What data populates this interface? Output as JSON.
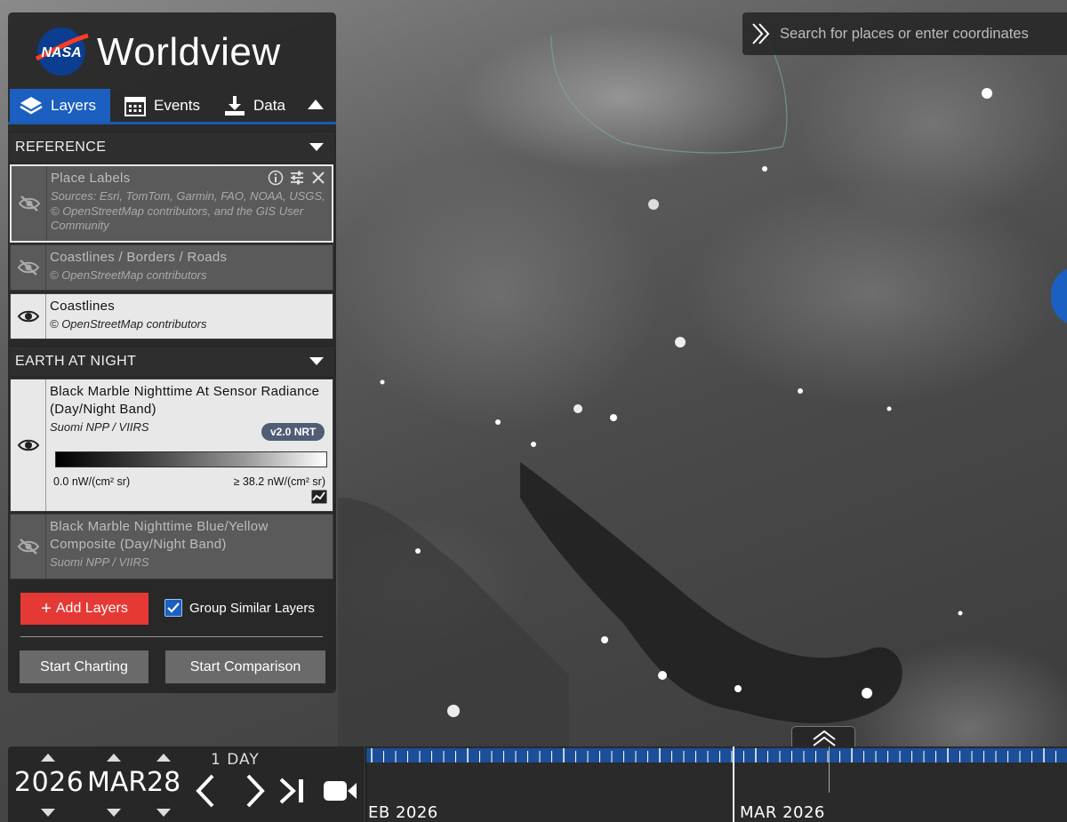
{
  "app": {
    "title": "Worldview",
    "logo_text": "NASA"
  },
  "tabs": [
    {
      "label": "Layers",
      "icon": "layers-icon",
      "active": true
    },
    {
      "label": "Events",
      "icon": "calendar-icon",
      "active": false
    },
    {
      "label": "Data",
      "icon": "download-icon",
      "active": false
    }
  ],
  "groups": {
    "reference": {
      "title": "REFERENCE",
      "layers": [
        {
          "title": "Place Labels",
          "source": "Sources: Esri, TomTom, Garmin, FAO, NOAA, USGS, © OpenStreetMap contributors, and the GIS User Community",
          "visible": false
        },
        {
          "title": "Coastlines / Borders / Roads",
          "source": "© OpenStreetMap contributors",
          "visible": false
        },
        {
          "title": "Coastlines",
          "source": "© OpenStreetMap contributors",
          "visible": true
        }
      ]
    },
    "earth_at_night": {
      "title": "EARTH AT NIGHT",
      "layers": [
        {
          "title": "Black Marble Nighttime At Sensor Radiance (Day/Night Band)",
          "source": "Suomi NPP / VIIRS",
          "badge": "v2.0 NRT",
          "legend_min": "0.0 nW/(cm² sr)",
          "legend_max": "≥ 38.2 nW/(cm² sr)",
          "visible": true
        },
        {
          "title": "Black Marble Nighttime Blue/Yellow Composite (Day/Night Band)",
          "source": "Suomi NPP / VIIRS",
          "visible": false
        }
      ]
    }
  },
  "actions": {
    "add_layers": "Add Layers",
    "group_similar": "Group Similar Layers",
    "group_similar_checked": true,
    "start_charting": "Start Charting",
    "start_comparison": "Start Comparison"
  },
  "search": {
    "placeholder": "Search for places or enter coordinates"
  },
  "date": {
    "year": "2026",
    "month": "MAR",
    "day": "28",
    "interval": "1 DAY"
  },
  "timeline": {
    "labels": [
      "EB 2026",
      "MAR 2026"
    ]
  },
  "colors": {
    "accent": "#1b5fc0",
    "add_button": "#e53935",
    "panel": "#262626"
  }
}
